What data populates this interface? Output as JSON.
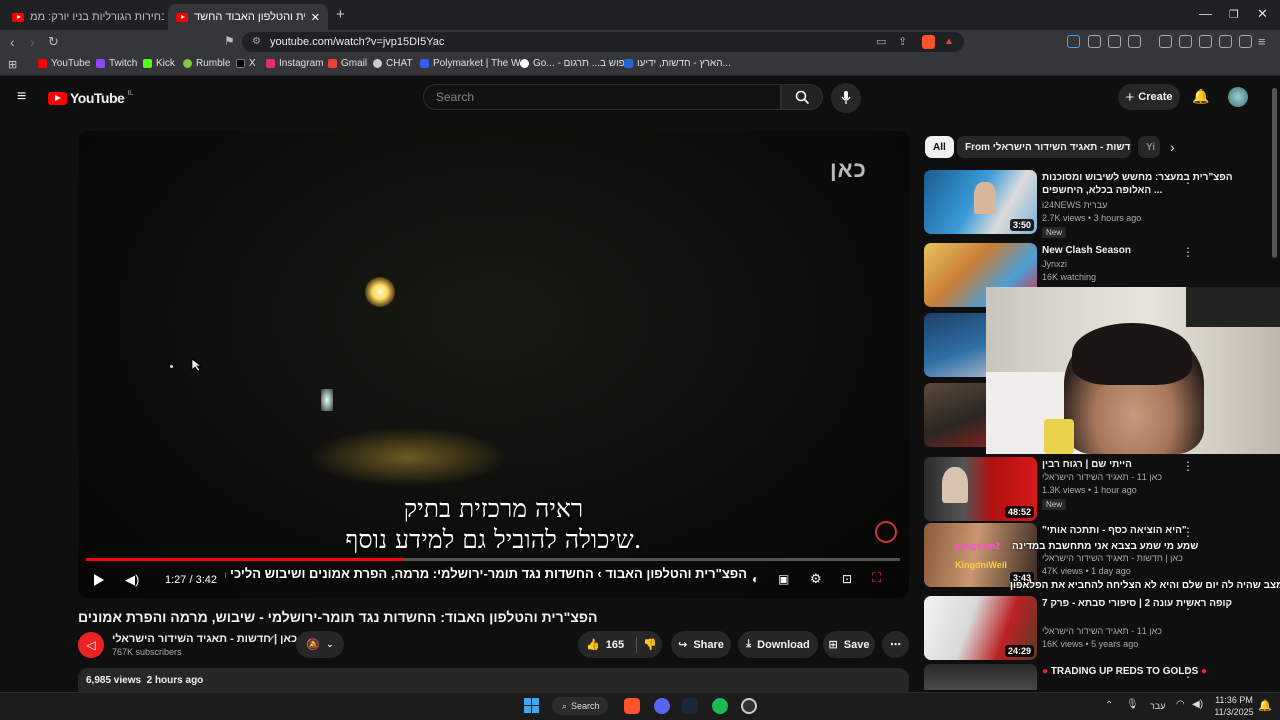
{
  "browser": {
    "tabs": [
      {
        "title": "יומיים לבחירות הגורליות בניו יורק: ממ...",
        "active": false
      },
      {
        "title": "הפצ\"רית והטלפון האבוד החשד...",
        "active": true
      }
    ],
    "new_tab": "+",
    "url": "youtube.com/watch?v=jvp15DI5Yac",
    "bookmarks": [
      "YouTube",
      "Twitch",
      "Kick",
      "Rumble",
      "X",
      "Instagram",
      "Gmail",
      "CHAT",
      "Polymarket | The W...",
      "Go... - חיפוש ב... תרגום",
      "הארץ - חדשות, ידיעו..."
    ]
  },
  "youtube": {
    "logo": "YouTube",
    "region": "IL",
    "search_placeholder": "Search",
    "create_label": "Create"
  },
  "video": {
    "watermark": "כאן",
    "subtitle_line1": "ראיה מרכזית בתיק",
    "subtitle_line2": "שיכולה להוביל גם למידע נוסף.",
    "time": "1:27 / 3:42",
    "progress": 0.39,
    "chapter": "הפצ\"רית והטלפון האבוד › החשדות נגד תומר-ירושלמי: מרמה, הפרת אמונים ושיבוש הליכי משפט",
    "title": "הפצ\"רית והטלפון האבוד: החשדות נגד תומר-ירושלמי - שיבוש, מרמה והפרת אמונים",
    "channel": "כאן | חדשות - תאגיד השידור הישראלי",
    "subscribers": "767K subscribers",
    "likes": "165",
    "share": "Share",
    "download": "Download",
    "save": "Save",
    "views": "6,985 views",
    "age": "2 hours ago"
  },
  "chips": [
    "All",
    "From כאן | חדשות - תאגיד השידור הישראלי",
    "Yi"
  ],
  "recommendations": [
    {
      "title": "הפצ\"רית במעצר: מחשש לשיבוש ומסוכנות האלופה בכלא, היחשפים ...",
      "channel": "i24NEWS עברית",
      "meta": "2.7K views • 3 hours ago",
      "badge": "New",
      "duration": "3:50"
    },
    {
      "title": "New Clash Season",
      "channel": "Jynxzi",
      "meta": "16K watching",
      "badge": "",
      "duration": ""
    },
    {
      "title": "",
      "channel": "",
      "meta": "",
      "badge": "",
      "duration": ""
    },
    {
      "title": "",
      "channel": "",
      "meta": "",
      "badge": "",
      "duration": ""
    },
    {
      "title": "הייתי שם | רגוח רבין",
      "channel": "כאן 11 - תאגיד השידור הישראלי",
      "meta": "1.3K views • 1 hour ago",
      "badge": "New",
      "duration": "48:52"
    },
    {
      "title": "\"היא הוציאה כסף - ותתכה אותי\"",
      "channel": "כאן | חדשות - תאגיד השידור הישראלי",
      "meta": "47K views • 1 day ago",
      "badge": "",
      "duration": "3:43"
    },
    {
      "title": "קופה ראשית עונה 2 | סיפורי סבתא - פרק 7",
      "channel": "כאן 11 - תאגיד השידור הישראלי",
      "meta": "16K views • 5 years ago",
      "badge": "",
      "duration": "24:29"
    },
    {
      "title": "TRADING UP REDS TO GOLDS",
      "channel": "",
      "meta": "",
      "badge": "",
      "duration": ""
    }
  ],
  "overlay": {
    "chat_line1": "שמע מי שמע בצבא אני מתחשבת במדינה",
    "chat_user1": "pengdam2",
    "chat_user2": "KingdniWell",
    "chat_line2": "אין מצב שהיה לה יום שלם והיא לא הצליחה להחביא את הפלאפון"
  },
  "taskbar": {
    "search": "Search",
    "lang": "עבר",
    "time": "11:36 PM",
    "date": "11/3/2025"
  }
}
